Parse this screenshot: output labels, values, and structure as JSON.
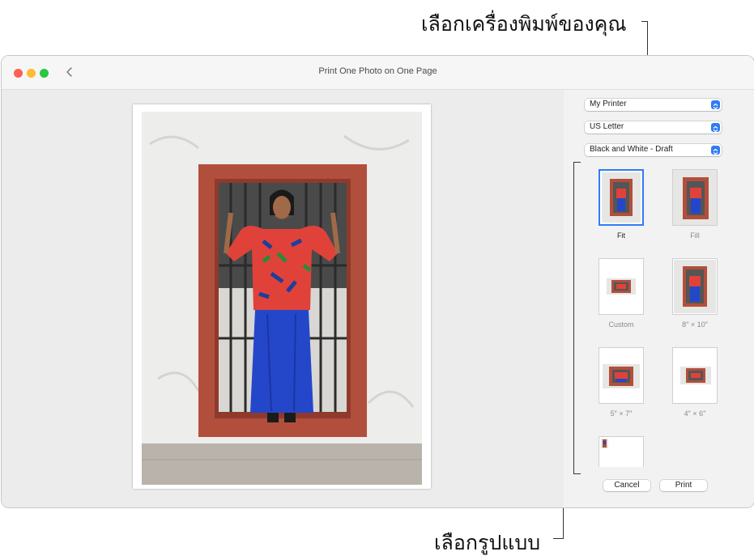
{
  "callouts": {
    "printer": "เลือกเครื่องพิมพ์ของคุณ",
    "layout": "เลือกรูปแบบ"
  },
  "window": {
    "title": "Print One Photo on One Page"
  },
  "sidebar": {
    "printer_popup": "My Printer",
    "paper_popup": "US Letter",
    "quality_popup": "Black and White - Draft",
    "layouts": [
      {
        "label": "Fit",
        "selected": true
      },
      {
        "label": "Fill",
        "selected": false
      },
      {
        "label": "Custom",
        "selected": false
      },
      {
        "label": "8″ × 10″",
        "selected": false
      },
      {
        "label": "5″ × 7″",
        "selected": false
      },
      {
        "label": "4″ × 6″",
        "selected": false
      },
      {
        "label": "",
        "selected": false
      }
    ],
    "cancel_label": "Cancel",
    "print_label": "Print"
  },
  "colors": {
    "accent": "#2f7cf6",
    "close": "#fe5f57",
    "minimize": "#febc2e",
    "zoom": "#28c840"
  }
}
